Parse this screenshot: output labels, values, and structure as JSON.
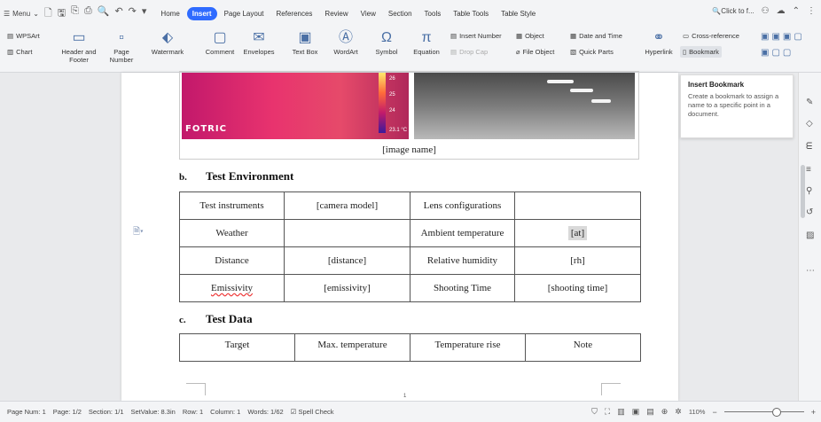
{
  "menu": {
    "label": "Menu"
  },
  "tabs": [
    "Home",
    "Insert",
    "Page Layout",
    "References",
    "Review",
    "View",
    "Section",
    "Tools",
    "Table Tools",
    "Table Style"
  ],
  "active_tab": "Insert",
  "search": {
    "label": "Click to f..."
  },
  "ribbon": {
    "wpsart": "WPSArt",
    "chart": "Chart",
    "header_footer": "Header and Footer",
    "page_number": "Page Number",
    "watermark": "Watermark",
    "comment": "Comment",
    "envelopes": "Envelopes",
    "text_box": "Text Box",
    "wordart": "WordArt",
    "symbol": "Symbol",
    "equation": "Equation",
    "insert_number": "Insert Number",
    "object": "Object",
    "date_time": "Date and Time",
    "drop_cap": "Drop Cap",
    "file_object": "File Object",
    "quick_parts": "Quick Parts",
    "hyperlink": "Hyperlink",
    "cross_reference": "Cross-reference",
    "bookmark": "Bookmark"
  },
  "tooltip": {
    "title": "Insert Bookmark",
    "desc": "Create a bookmark to assign a name to a specific point in a document."
  },
  "image": {
    "logo": "FOTRIC",
    "ticks": [
      "26",
      "25",
      "24",
      "23.1 °C"
    ]
  },
  "doc": {
    "caption": "[image name]",
    "section_b": {
      "num": "b.",
      "title": "Test Environment"
    },
    "env_table": [
      [
        "Test instruments",
        "[camera model]",
        "Lens configurations",
        ""
      ],
      [
        "Weather",
        "",
        "Ambient temperature",
        "[at]"
      ],
      [
        "Distance",
        "[distance]",
        "Relative humidity",
        "[rh]"
      ],
      [
        "Emissivity",
        "[emissivity]",
        "Shooting Time",
        "[shooting time]"
      ]
    ],
    "section_c": {
      "num": "c.",
      "title": "Test Data"
    },
    "data_table_headers": [
      "Target",
      "Max. temperature",
      "Temperature rise",
      "Note"
    ],
    "page_marker": "1"
  },
  "status": {
    "page_num": "Page Num: 1",
    "page": "Page: 1/2",
    "section": "Section: 1/1",
    "setvalue": "SetValue: 8.3in",
    "row": "Row: 1",
    "column": "Column: 1",
    "words": "Words: 1/62",
    "spell_check": "Spell Check",
    "zoom": "110%"
  }
}
